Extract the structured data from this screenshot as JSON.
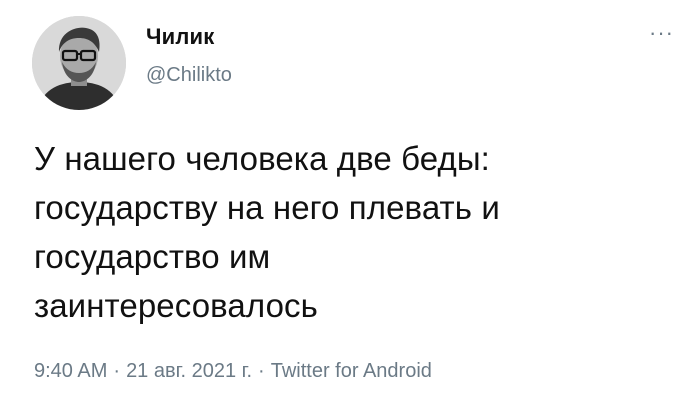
{
  "author": {
    "display_name": "Чилик",
    "handle": "@Chilikto"
  },
  "menu_label": "···",
  "body_lines": [
    "У нашего человека две беды:",
    "государству на него плевать и",
    "государство им",
    "заинтересовалось"
  ],
  "meta": {
    "time": "9:40 AM",
    "date": "21 авг. 2021 г.",
    "source": "Twitter for Android",
    "separator": "·"
  },
  "colors": {
    "text": "#111111",
    "muted": "#6b7a86",
    "background": "#ffffff"
  },
  "icons": {
    "avatar": "profile-photo",
    "menu": "more-options-dots"
  }
}
